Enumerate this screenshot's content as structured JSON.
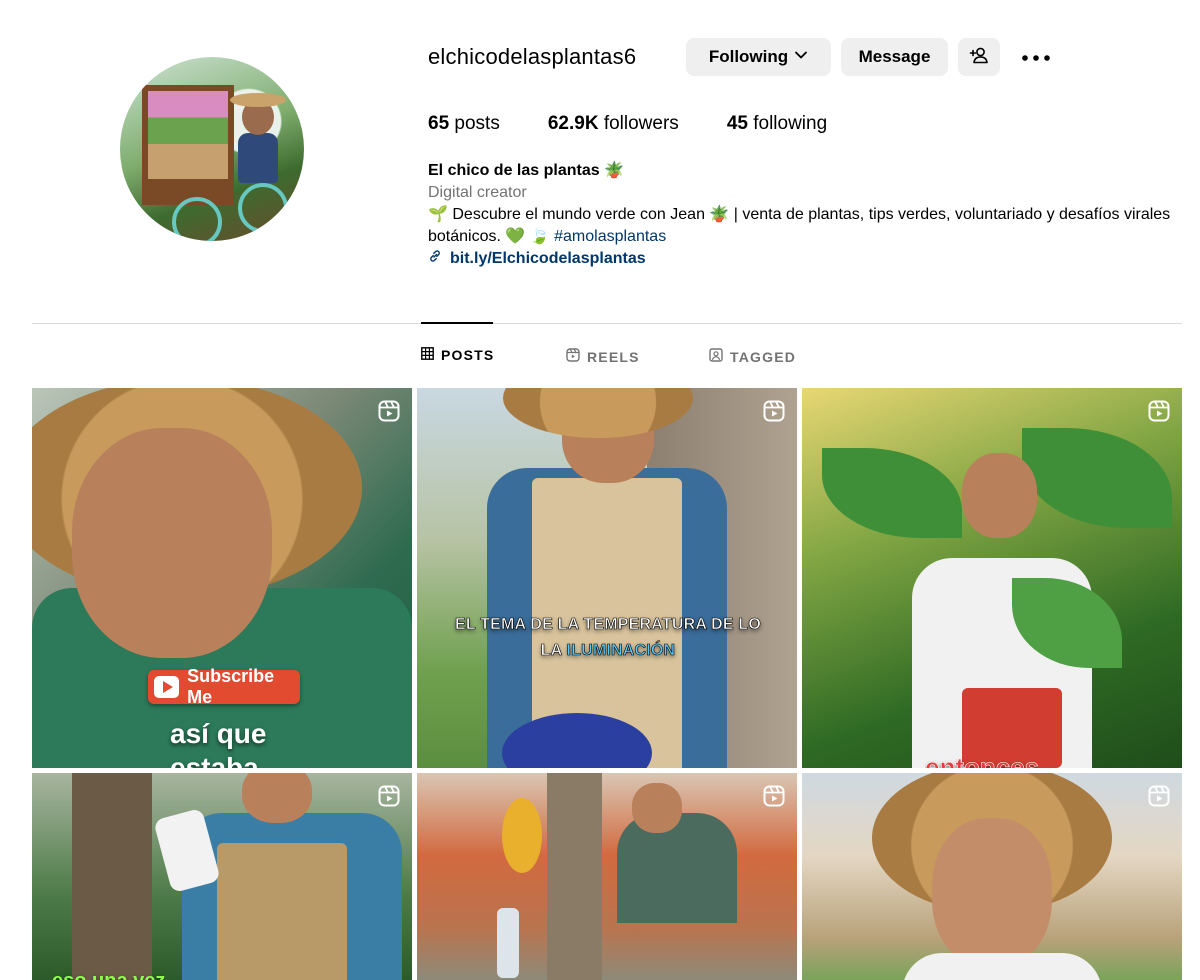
{
  "profile": {
    "username": "elchicodelasplantas6",
    "following_button": "Following",
    "message_button": "Message",
    "stats": {
      "posts_count": "65",
      "posts_label": "posts",
      "followers_count": "62.9K",
      "followers_label": "followers",
      "following_count": "45",
      "following_label": "following"
    },
    "bio": {
      "name": "El chico de las plantas 🪴",
      "category": "Digital creator",
      "text": "🌱 Descubre el mundo verde con Jean 🪴 | venta de plantas, tips verdes, voluntariado y desafíos virales botánicos. 💚 🍃",
      "hashtag": "#amolasplantas",
      "link": "bit.ly/Elchicodelasplantas"
    }
  },
  "tabs": [
    {
      "label": "POSTS",
      "icon": "grid-icon",
      "active": true
    },
    {
      "label": "REELS",
      "icon": "reels-icon",
      "active": false
    },
    {
      "label": "TAGGED",
      "icon": "tagged-icon",
      "active": false
    }
  ],
  "posts": [
    {
      "overlay_badge": "Subscribe Me",
      "caption_line1": "así que",
      "caption_line2": "estaba"
    },
    {
      "caption_line1": "EL TEMA DE LA TEMPERATURA DE LO",
      "caption_line2_prefix": "LA ",
      "caption_line2_highlight": "ILUMINACIÓN"
    },
    {
      "caption_line1": "entonces"
    },
    {
      "caption_line1": "eso una vez"
    },
    {},
    {}
  ],
  "colors": {
    "button_bg": "#efefef",
    "link": "#00376b",
    "muted": "#737373",
    "divider": "#dbdbdb"
  }
}
